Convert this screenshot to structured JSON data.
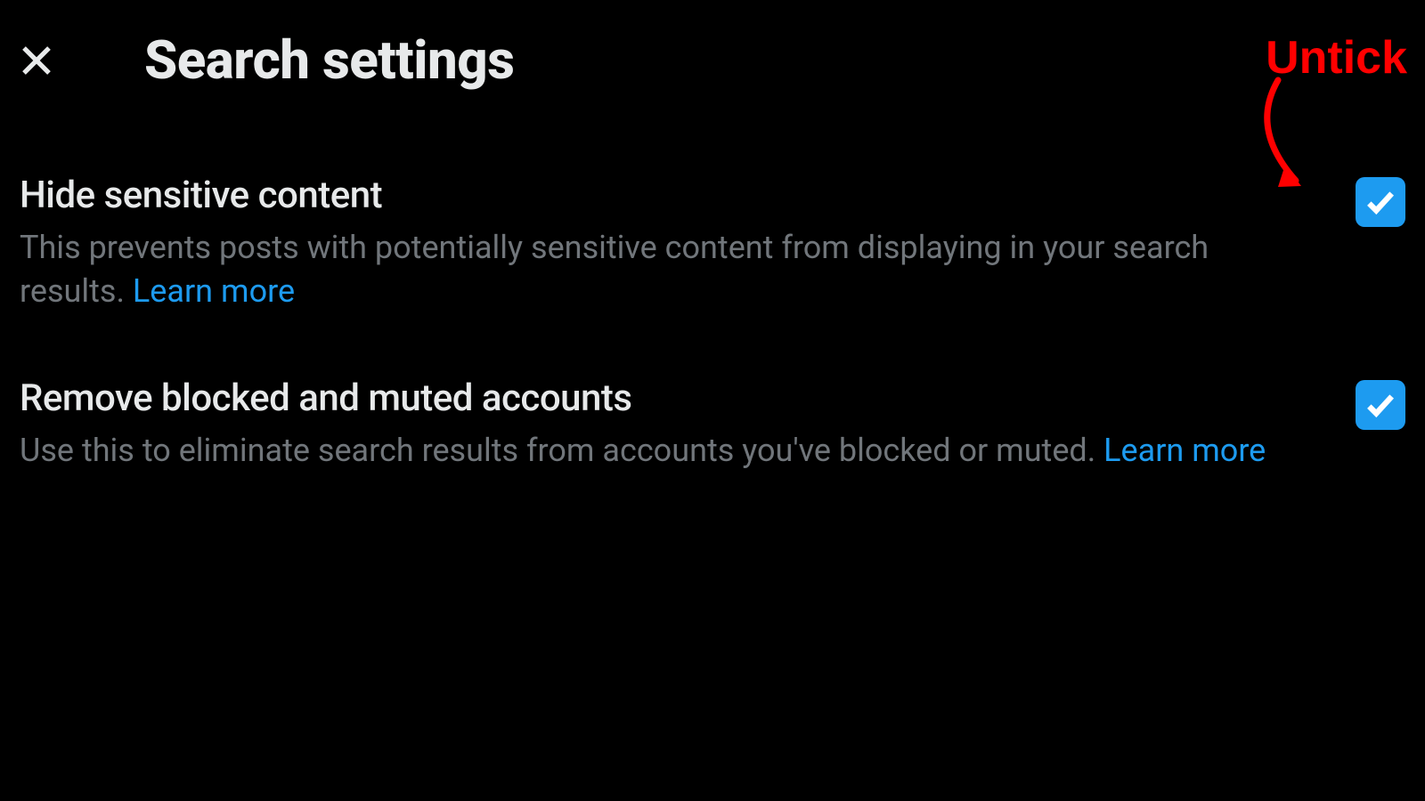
{
  "header": {
    "title": "Search settings"
  },
  "settings": [
    {
      "title": "Hide sensitive content",
      "description": "This prevents posts with potentially sensitive content from displaying in your search results. ",
      "learn_more": "Learn more",
      "checked": true
    },
    {
      "title": "Remove blocked and muted accounts",
      "description": "Use this to eliminate search results from accounts you've blocked or muted. ",
      "learn_more": "Learn more",
      "checked": true
    }
  ],
  "annotation": {
    "label": "Untick"
  }
}
